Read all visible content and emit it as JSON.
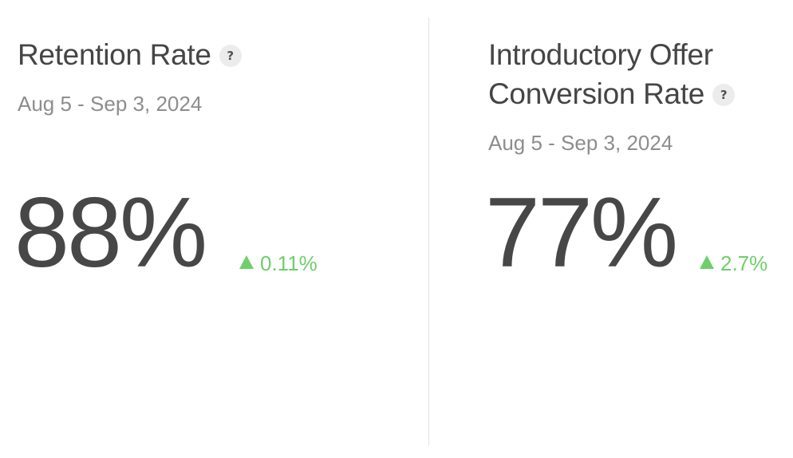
{
  "colors": {
    "positive": "#6fcf6a",
    "text_primary": "#454545",
    "text_secondary": "#8d8d8d",
    "divider": "#e3e3e3"
  },
  "metrics": [
    {
      "title_line1": "Retention Rate",
      "title_line2": "",
      "help_icon": "question-mark-icon",
      "help_symbol": "?",
      "date_range": "Aug 5 - Sep 3, 2024",
      "value": "88%",
      "change_icon": "up-triangle-icon",
      "change": "0.11%"
    },
    {
      "title_line1": "Introductory Offer",
      "title_line2": "Conversion Rate",
      "help_icon": "question-mark-icon",
      "help_symbol": "?",
      "date_range": "Aug 5 - Sep 3, 2024",
      "value": "77%",
      "change_icon": "up-triangle-icon",
      "change": "2.7%"
    }
  ]
}
